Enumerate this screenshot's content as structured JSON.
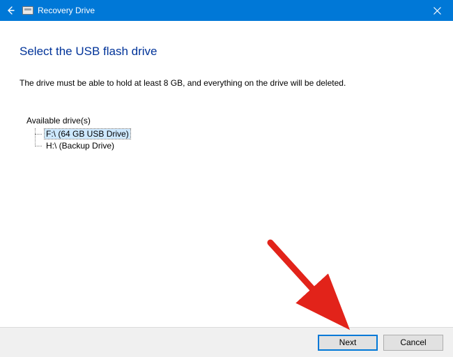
{
  "titlebar": {
    "title": "Recovery Drive"
  },
  "main": {
    "heading": "Select the USB flash drive",
    "description": "The drive must be able to hold at least 8 GB, and everything on the drive will be deleted.",
    "list_label": "Available drive(s)",
    "drives": [
      {
        "label": "F:\\ (64 GB USB Drive)",
        "selected": true
      },
      {
        "label": "H:\\ (Backup Drive)",
        "selected": false
      }
    ]
  },
  "footer": {
    "next": "Next",
    "cancel": "Cancel"
  }
}
